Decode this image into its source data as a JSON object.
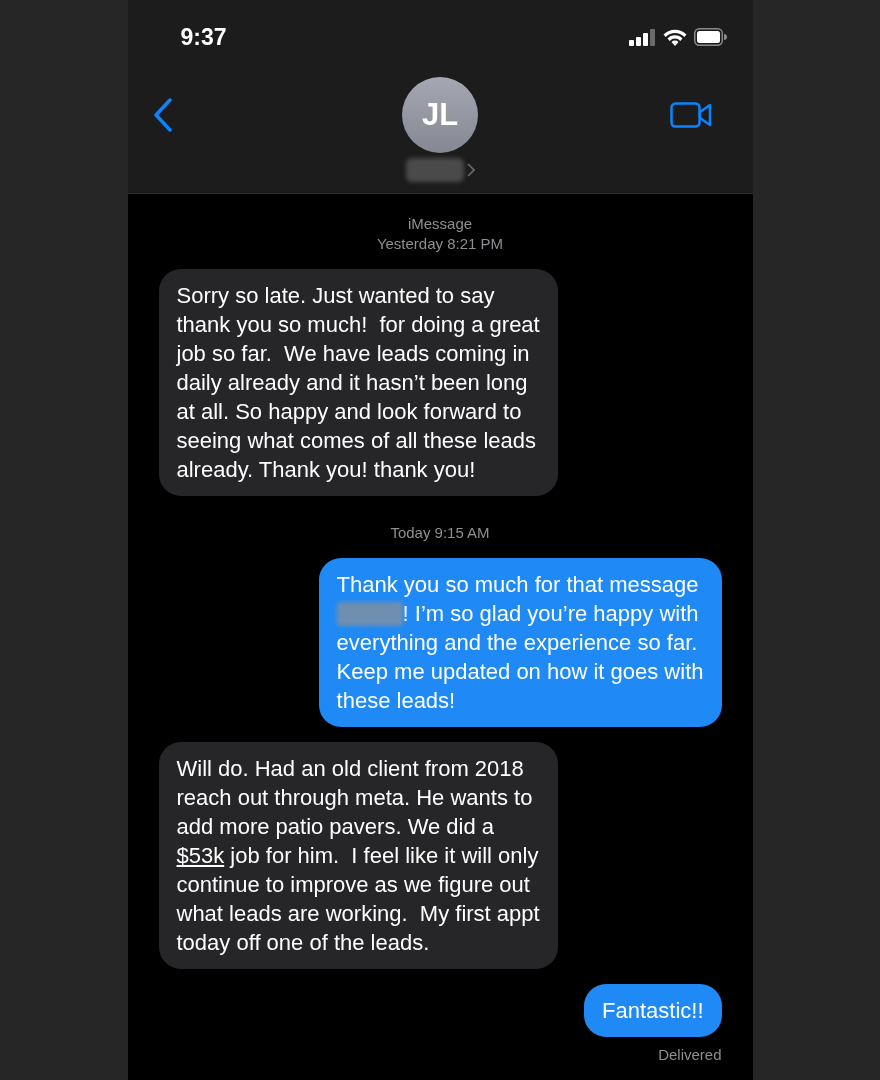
{
  "status_bar": {
    "time": "9:37"
  },
  "contact": {
    "initials": "JL",
    "name_redacted": true
  },
  "messages": [
    {
      "kind": "timestamp",
      "lines": [
        "iMessage",
        "Yesterday 8:21 PM"
      ]
    },
    {
      "kind": "received",
      "lines": [
        [
          {
            "kind": "plain",
            "text": "Sorry so late. Just wanted to say"
          }
        ],
        [
          {
            "kind": "plain",
            "text": "thank you so much!  for doing a great"
          }
        ],
        [
          {
            "kind": "plain",
            "text": "job so far.  We have leads coming in"
          }
        ],
        [
          {
            "kind": "plain",
            "text": "daily already and it hasn’t been long"
          }
        ],
        [
          {
            "kind": "plain",
            "text": "at all. So happy and look forward to"
          }
        ],
        [
          {
            "kind": "plain",
            "text": "seeing what comes of all these leads"
          }
        ],
        [
          {
            "kind": "plain",
            "text": "already. Thank you! thank you!"
          }
        ]
      ]
    },
    {
      "kind": "timestamp",
      "lines": [
        "Today 9:15 AM"
      ]
    },
    {
      "kind": "sent",
      "lines": [
        [
          {
            "kind": "plain",
            "text": "Thank you so much for that message"
          }
        ],
        [
          {
            "kind": "redacted"
          },
          {
            "kind": "plain",
            "text": "! I’m so glad you’re happy with"
          }
        ],
        [
          {
            "kind": "plain",
            "text": "everything and the experience so far."
          }
        ],
        [
          {
            "kind": "plain",
            "text": "Keep me updated on how it goes with"
          }
        ],
        [
          {
            "kind": "plain",
            "text": "these leads!"
          }
        ]
      ]
    },
    {
      "kind": "received",
      "lines": [
        [
          {
            "kind": "plain",
            "text": "Will do. Had an old client from 2018"
          }
        ],
        [
          {
            "kind": "plain",
            "text": "reach out through meta. He wants to"
          }
        ],
        [
          {
            "kind": "plain",
            "text": "add more patio pavers. We did a"
          }
        ],
        [
          {
            "kind": "link",
            "text": "$53k"
          },
          {
            "kind": "plain",
            "text": " job for him.  I feel like it will only"
          }
        ],
        [
          {
            "kind": "plain",
            "text": "continue to improve as we figure out"
          }
        ],
        [
          {
            "kind": "plain",
            "text": "what leads are working.  My first appt"
          }
        ],
        [
          {
            "kind": "plain",
            "text": "today off one of the leads."
          }
        ]
      ]
    },
    {
      "kind": "sent",
      "lines": [
        [
          {
            "kind": "plain",
            "text": "Fantastic!!"
          }
        ]
      ]
    },
    {
      "kind": "status",
      "lines": [
        "Delivered"
      ]
    }
  ]
}
